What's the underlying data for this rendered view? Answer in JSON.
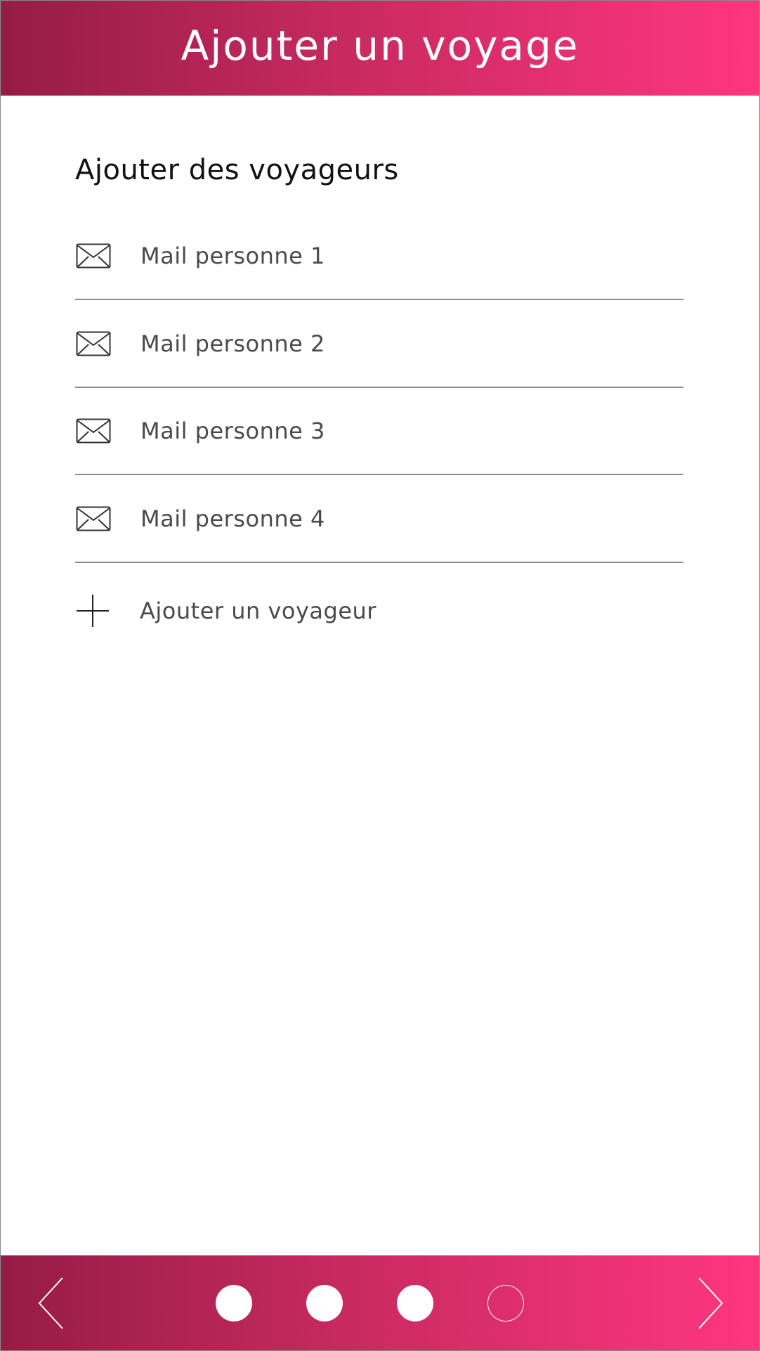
{
  "header": {
    "title": "Ajouter un voyage"
  },
  "section": {
    "title": "Ajouter des voyageurs"
  },
  "mail_fields": [
    {
      "placeholder": "Mail personne 1",
      "icon": "mail-icon"
    },
    {
      "placeholder": "Mail personne 2",
      "icon": "mail-icon"
    },
    {
      "placeholder": "Mail personne 3",
      "icon": "mail-icon"
    },
    {
      "placeholder": "Mail personne 4",
      "icon": "mail-icon"
    }
  ],
  "add_traveler": {
    "label": "Ajouter un voyageur",
    "icon": "plus-icon"
  },
  "pagination": {
    "total_steps": 4,
    "completed_steps": 3,
    "prev_icon": "chevron-left-icon",
    "next_icon": "chevron-right-icon"
  },
  "colors": {
    "gradient_start": "#951c45",
    "gradient_end": "#ff367f",
    "text_primary": "#111111",
    "text_secondary": "#4a4a4a",
    "divider": "#8c8c8c"
  }
}
